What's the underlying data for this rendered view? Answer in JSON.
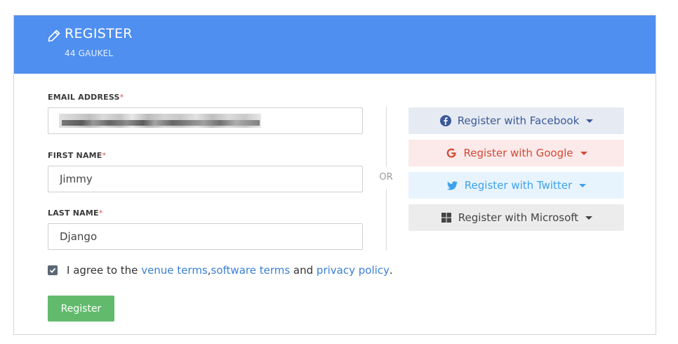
{
  "header": {
    "icon": "pencil-icon",
    "title": "REGISTER",
    "subtitle": "44 GAUKEL",
    "bg_color": "#4f8ff0"
  },
  "form": {
    "email": {
      "label": "EMAIL ADDRESS",
      "required_marker": "*",
      "value": ""
    },
    "first_name": {
      "label": "FIRST NAME",
      "required_marker": "*",
      "value": "Jimmy"
    },
    "last_name": {
      "label": "LAST NAME",
      "required_marker": "*",
      "value": "Django"
    }
  },
  "divider_text": "OR",
  "social": {
    "facebook": {
      "label": "Register with Facebook",
      "icon": "facebook-icon",
      "color": "#3b5998"
    },
    "google": {
      "label": "Register with Google",
      "icon": "google-icon",
      "color": "#d04a35"
    },
    "twitter": {
      "label": "Register with Twitter",
      "icon": "twitter-icon",
      "color": "#3ea1ec"
    },
    "microsoft": {
      "label": "Register with Microsoft",
      "icon": "windows-icon",
      "color": "#444444"
    }
  },
  "agreement": {
    "checked": true,
    "prefix": "I agree to the ",
    "venue_terms": "venue terms",
    "comma": ",",
    "software_terms": "software terms",
    "and": " and ",
    "privacy_policy": "privacy policy",
    "suffix": "."
  },
  "register_button": {
    "label": "Register",
    "color": "#62bb6d"
  }
}
